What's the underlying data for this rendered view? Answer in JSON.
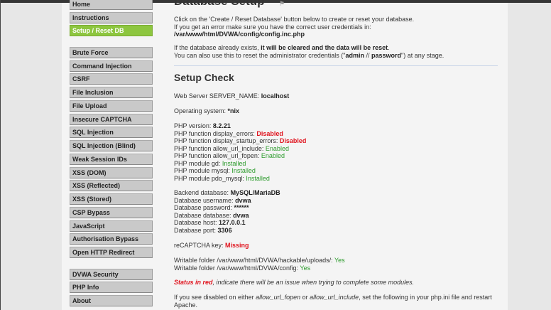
{
  "menu": {
    "items": [
      {
        "label": "Home",
        "selected": false
      },
      {
        "label": "Instructions",
        "selected": false
      },
      {
        "label": "Setup / Reset DB",
        "selected": true
      },
      {
        "label": "Brute Force"
      },
      {
        "label": "Command Injection"
      },
      {
        "label": "CSRF"
      },
      {
        "label": "File Inclusion"
      },
      {
        "label": "File Upload"
      },
      {
        "label": "Insecure CAPTCHA"
      },
      {
        "label": "SQL Injection"
      },
      {
        "label": "SQL Injection (Blind)"
      },
      {
        "label": "Weak Session IDs"
      },
      {
        "label": "XSS (DOM)"
      },
      {
        "label": "XSS (Reflected)"
      },
      {
        "label": "XSS (Stored)"
      },
      {
        "label": "CSP Bypass"
      },
      {
        "label": "JavaScript"
      },
      {
        "label": "Authorisation Bypass"
      },
      {
        "label": "Open HTTP Redirect"
      },
      {
        "label": "DVWA Security"
      },
      {
        "label": "PHP Info"
      },
      {
        "label": "About"
      }
    ]
  },
  "page": {
    "title": "Database Setup",
    "help_icon": "help-icon",
    "intro1": "Click on the 'Create / Reset Database' button below to create or reset your database.",
    "intro2_a": "If you get an error make sure you have the correct user credentials in: ",
    "intro2_path": "/var/www/html/DVWA/config/config.inc.php",
    "exists_a": "If the database already exists, ",
    "exists_b": "it will be cleared and the data will be reset",
    "exists_c": ".",
    "reset_a": "You can also use this to reset the administrator credentials (\"",
    "reset_user": "admin",
    "reset_sep": " // ",
    "reset_pass": "password",
    "reset_b": "\") at any stage.",
    "setup_check": "Setup Check"
  },
  "checks": {
    "server_label": "Web Server SERVER_NAME: ",
    "server": "localhost",
    "os_label": "Operating system: ",
    "os": "*nix",
    "php_version_label": "PHP version: ",
    "php_version": "8.2.21",
    "display_errors_label": "PHP function display_errors: ",
    "display_errors": "Disabled",
    "display_startup_errors_label": "PHP function display_startup_errors: ",
    "display_startup_errors": "Disabled",
    "allow_url_include_label": "PHP function allow_url_include: ",
    "allow_url_include": "Enabled",
    "allow_url_fopen_label": "PHP function allow_url_fopen: ",
    "allow_url_fopen": "Enabled",
    "gd_label": "PHP module gd: ",
    "gd": "Installed",
    "mysql_label": "PHP module mysql: ",
    "mysql": "Installed",
    "pdo_label": "PHP module pdo_mysql: ",
    "pdo": "Installed",
    "backend_label": "Backend database: ",
    "backend": "MySQL/MariaDB",
    "db_user_label": "Database username: ",
    "db_user": "dvwa",
    "db_pass_label": "Database password: ",
    "db_pass": "******",
    "db_name_label": "Database database: ",
    "db_name": "dvwa",
    "db_host_label": "Database host: ",
    "db_host": "127.0.0.1",
    "db_port_label": "Database port: ",
    "db_port": "3306",
    "recaptcha_label": "reCAPTCHA key: ",
    "recaptcha": "Missing",
    "uploads_label": "Writable folder /var/www/html/DVWA/hackable/uploads/: ",
    "uploads": "Yes",
    "config_label": "Writable folder /var/www/html/DVWA/config: ",
    "config": "Yes",
    "status_red": "Status in red",
    "status_note": ", indicate there will be an issue when trying to complete some modules.",
    "note_a": "If you see disabled on either ",
    "note_fopen": "allow_url_fopen",
    "note_or": " or ",
    "note_include": "allow_url_include",
    "note_b": ", set the following in your php.ini file and restart Apache."
  },
  "colors": {
    "accent": "#8dc63f",
    "error": "#e0141e",
    "ok": "#2a9a2a"
  }
}
